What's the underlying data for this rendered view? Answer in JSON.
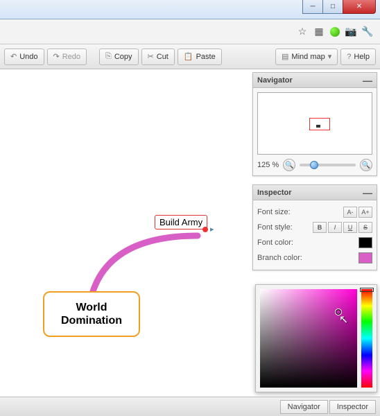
{
  "toolbar": {
    "undo": "Undo",
    "redo": "Redo",
    "copy": "Copy",
    "cut": "Cut",
    "paste": "Paste",
    "mindmap": "Mind map",
    "help": "Help"
  },
  "canvas": {
    "central_node": "World Domination",
    "child_node": "Build Army"
  },
  "navigator": {
    "title": "Navigator",
    "zoom_label": "125 %"
  },
  "inspector": {
    "title": "Inspector",
    "font_size_label": "Font size:",
    "font_size_dec": "A-",
    "font_size_inc": "A+",
    "font_style_label": "Font style:",
    "bold": "B",
    "italic": "I",
    "underline": "U",
    "strike": "S",
    "font_color_label": "Font color:",
    "branch_color_label": "Branch color:",
    "font_color_value": "#000000",
    "branch_color_value": "#d85fc5"
  },
  "statusbar": {
    "navigator_tab": "Navigator",
    "inspector_tab": "Inspector"
  }
}
